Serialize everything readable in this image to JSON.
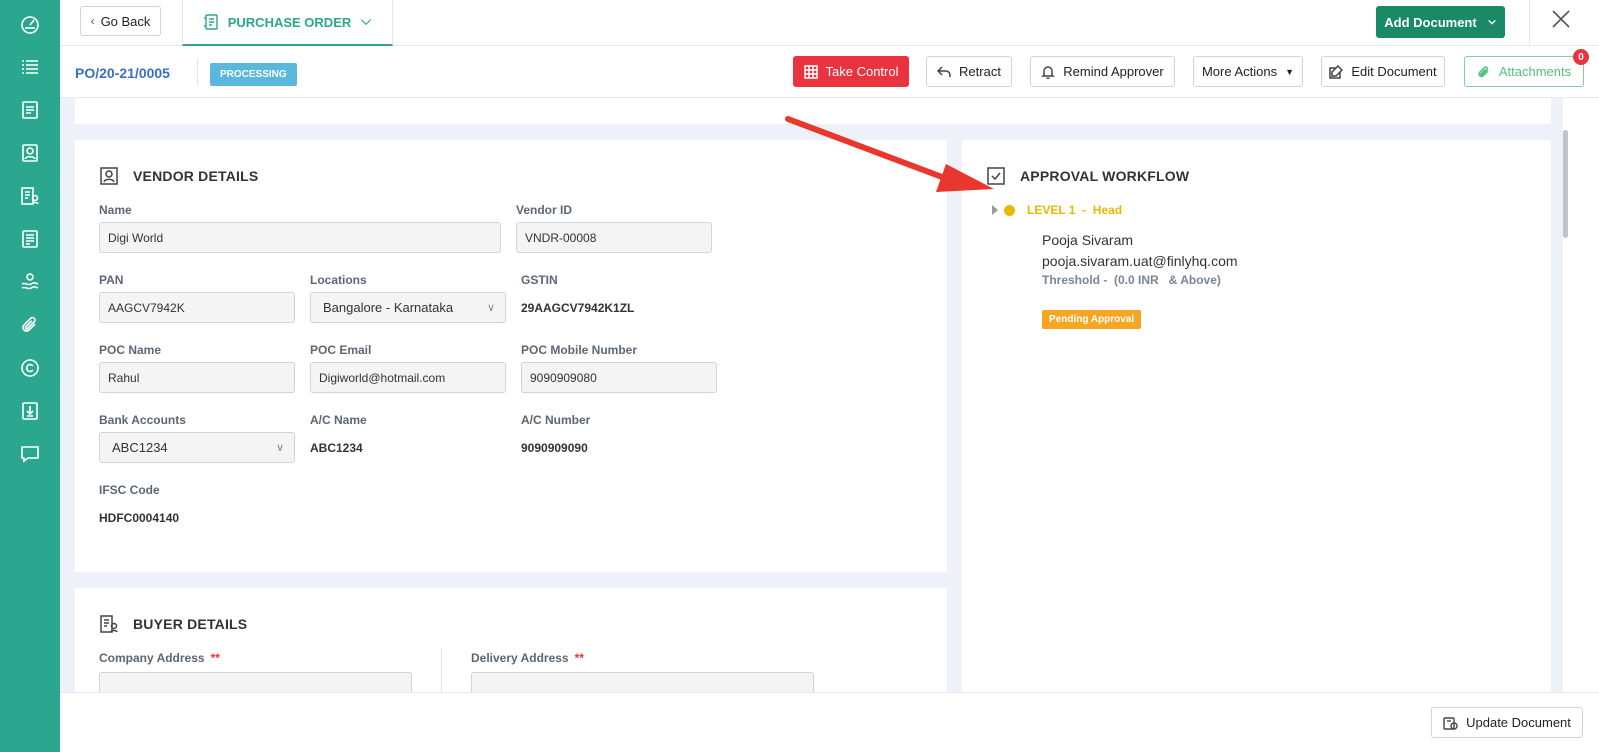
{
  "topbar": {
    "go_back_label": "Go Back",
    "doc_type_label": "PURCHASE ORDER",
    "add_document_label": "Add Document"
  },
  "subheader": {
    "po_number": "PO/20-21/0005",
    "status": "PROCESSING",
    "actions": {
      "take_control": "Take Control",
      "retract": "Retract",
      "remind_approver": "Remind Approver",
      "more_actions": "More Actions",
      "edit_document": "Edit Document",
      "attachments": "Attachments",
      "attachments_count": "0"
    }
  },
  "vendor": {
    "title": "VENDOR DETAILS",
    "name_label": "Name",
    "name_value": "Digi World",
    "vendor_id_label": "Vendor ID",
    "vendor_id_value": "VNDR-00008",
    "pan_label": "PAN",
    "pan_value": "AAGCV7942K",
    "locations_label": "Locations",
    "locations_value": "Bangalore - Karnataka",
    "gstin_label": "GSTIN",
    "gstin_value": "29AAGCV7942K1ZL",
    "poc_name_label": "POC Name",
    "poc_name_value": "Rahul",
    "poc_email_label": "POC Email",
    "poc_email_value": "Digiworld@hotmail.com",
    "poc_mobile_label": "POC Mobile Number",
    "poc_mobile_value": "9090909080",
    "bank_accounts_label": "Bank Accounts",
    "bank_accounts_value": "ABC1234",
    "ac_name_label": "A/C Name",
    "ac_name_value": "ABC1234",
    "ac_number_label": "A/C Number",
    "ac_number_value": "9090909090",
    "ifsc_label": "IFSC Code",
    "ifsc_value": "HDFC0004140"
  },
  "approval": {
    "title": "APPROVAL WORKFLOW",
    "level_label": "LEVEL 1  -  Head",
    "approver_name": "Pooja Sivaram",
    "approver_email": "pooja.sivaram.uat@finlyhq.com",
    "threshold": "Threshold -  (0.0 INR   & Above)",
    "status": "Pending Approval"
  },
  "buyer": {
    "title": "BUYER DETAILS",
    "company_address_label": "Company Address",
    "delivery_address_label": "Delivery Address",
    "required_marker": "**"
  },
  "bottom": {
    "update_document_label": "Update Document"
  },
  "colors": {
    "sidebar": "#2ba68f",
    "primary_green": "#198a65",
    "danger_red": "#e9343f",
    "status_blue": "#5ab8dd",
    "level_yellow": "#e8b900",
    "pending_orange": "#f5a623",
    "annotation_arrow": "#e8372c"
  }
}
